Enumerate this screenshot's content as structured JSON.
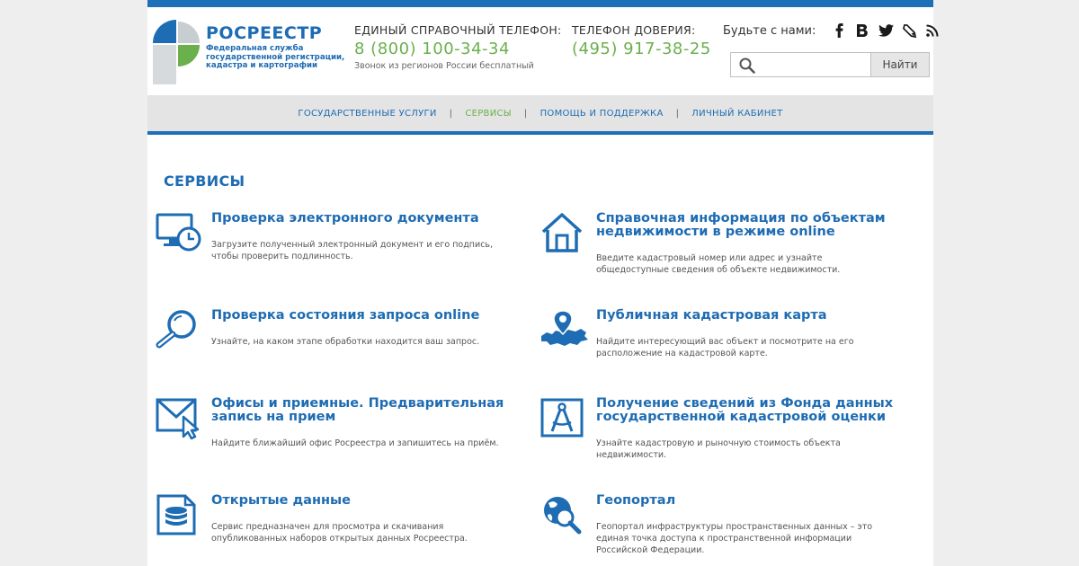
{
  "brand": {
    "name": "РОСРЕЕСТР",
    "subtitle_lines": [
      "Федеральная служба",
      "государственной регистрации,",
      "кадастра и картографии"
    ]
  },
  "phones": {
    "main_label": "ЕДИНЫЙ СПРАВОЧНЫЙ ТЕЛЕФОН:",
    "main_number": "8 (800) 100-34-34",
    "main_note": "Звонок из регионов России бесплатный",
    "trust_label": "ТЕЛЕФОН ДОВЕРИЯ:",
    "trust_number": "(495) 917-38-25"
  },
  "social": {
    "label": "Будьте с нами:",
    "icons": [
      "facebook-icon",
      "vkontakte-icon",
      "twitter-icon",
      "livejournal-icon",
      "rss-icon"
    ]
  },
  "search": {
    "placeholder": "",
    "value": "",
    "button_label": "Найти"
  },
  "nav": {
    "items": [
      {
        "label": "ГОСУДАРСТВЕННЫЕ УСЛУГИ",
        "active": false
      },
      {
        "label": "СЕРВИСЫ",
        "active": true
      },
      {
        "label": "ПОМОЩЬ И ПОДДЕРЖКА",
        "active": false
      },
      {
        "label": "ЛИЧНЫЙ КАБИНЕТ",
        "active": false
      }
    ],
    "separator": "|"
  },
  "section_title": "СЕРВИСЫ",
  "services": [
    {
      "icon": "monitor-clock-icon",
      "title_lines": [
        "Проверка электронного документа"
      ],
      "desc_lines": [
        "Загрузите полученный электронный документ и его подпись,",
        "чтобы проверить подлинность."
      ]
    },
    {
      "icon": "house-icon",
      "title_lines": [
        "Справочная информация по объектам",
        "недвижимости в режиме online"
      ],
      "desc_lines": [
        "Введите кадастровый номер или адрес и узнайте",
        "общедоступные сведения об объекте недвижимости."
      ]
    },
    {
      "icon": "magnifier-icon",
      "title_lines": [
        "Проверка состояния запроса online"
      ],
      "desc_lines": [
        "Узнайте, на каком этапе обработки находится ваш запрос."
      ]
    },
    {
      "icon": "map-pin-icon",
      "title_lines": [
        "Публичная кадастровая карта"
      ],
      "desc_lines": [
        "Найдите интересующий вас объект и посмотрите на его",
        "расположение на кадастровой карте."
      ]
    },
    {
      "icon": "envelope-cursor-icon",
      "title_lines": [
        "Офисы и приемные. Предварительная",
        "запись на прием"
      ],
      "desc_lines": [
        "Найдите ближайший офис Росреестра и запишитесь на приём."
      ]
    },
    {
      "icon": "compass-icon",
      "title_lines": [
        "Получение сведений из Фонда данных",
        "государственной кадастровой оценки"
      ],
      "desc_lines": [
        "Узнайте кадастровую и рыночную стоимость объекта",
        "недвижимости."
      ]
    },
    {
      "icon": "database-icon",
      "title_lines": [
        "Открытые данные"
      ],
      "desc_lines": [
        "Сервис предназначен для просмотра и скачивания",
        "опубликованных наборов открытых данных Росреестра."
      ]
    },
    {
      "icon": "globe-search-icon",
      "title_lines": [
        "Геопортал"
      ],
      "desc_lines": [
        "Геопортал инфраструктуры пространственных данных – это",
        "единая точка доступа к пространственной информации",
        "Российской Федерации."
      ]
    }
  ],
  "colors": {
    "brand_blue": "#1e6cb3",
    "accent_green": "#6ab04c",
    "nav_bg": "#e4e4e4"
  }
}
